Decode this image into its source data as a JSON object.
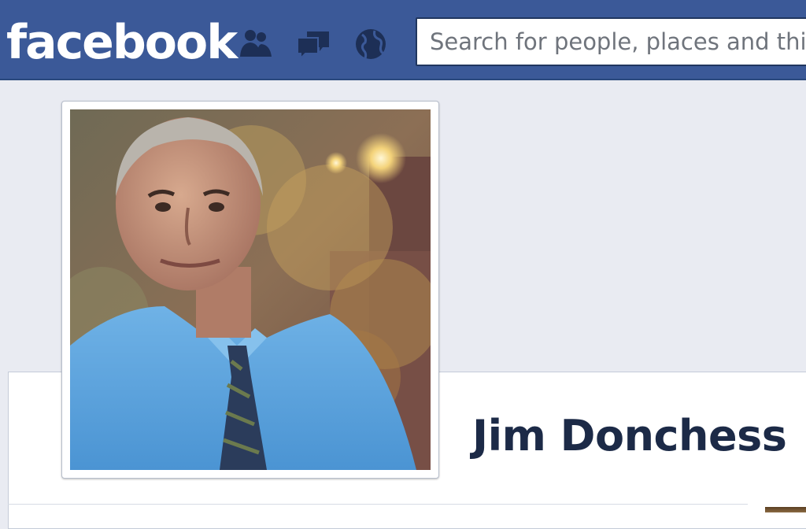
{
  "header": {
    "logo_text": "facebook",
    "search_placeholder": "Search for people, places and things",
    "icons": [
      "friend-requests-icon",
      "messages-icon",
      "notifications-globe-icon"
    ]
  },
  "profile": {
    "name": "Jim Donchess"
  },
  "colors": {
    "brand_blue": "#3b5998",
    "page_background": "#e9ebf2",
    "name_text": "#1c2a47"
  }
}
